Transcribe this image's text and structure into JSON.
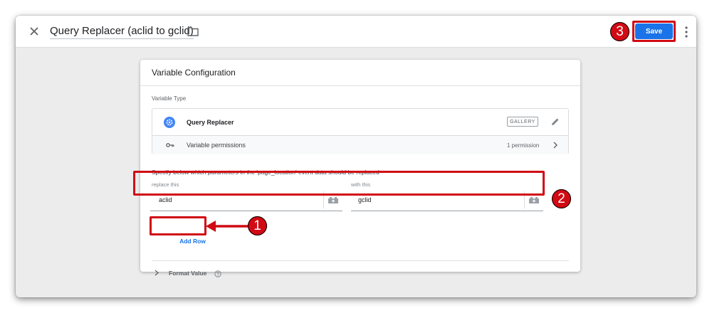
{
  "header": {
    "title": "Query Replacer (aclid to gclid)",
    "save_label": "Save"
  },
  "card": {
    "title": "Variable Configuration",
    "variable_type_label": "Variable Type",
    "variable_type_name": "Query Replacer",
    "gallery_label": "GALLERY",
    "permissions_label": "Variable permissions",
    "permissions_count": "1 permission",
    "instruction": "Specify below which parameters in the 'page_location' event data should be replaced",
    "replace_label": "replace this",
    "with_label": "with this",
    "rows": [
      {
        "replace": "aclid",
        "with": "gclid"
      }
    ],
    "add_row_label": "Add Row",
    "format_value_label": "Format Value"
  },
  "annotations": {
    "step1": "1",
    "step2": "2",
    "step3": "3",
    "highlight_color": "#d10a14"
  },
  "colors": {
    "accent": "#1a73e8",
    "annotation_red": "#d10a14"
  },
  "icons": [
    "close-icon",
    "folder-icon",
    "more-vert-icon",
    "gear-icon",
    "pencil-icon",
    "key-icon",
    "chevron-right-icon",
    "variable-picker-icon",
    "chevron-down-icon",
    "help-icon"
  ]
}
